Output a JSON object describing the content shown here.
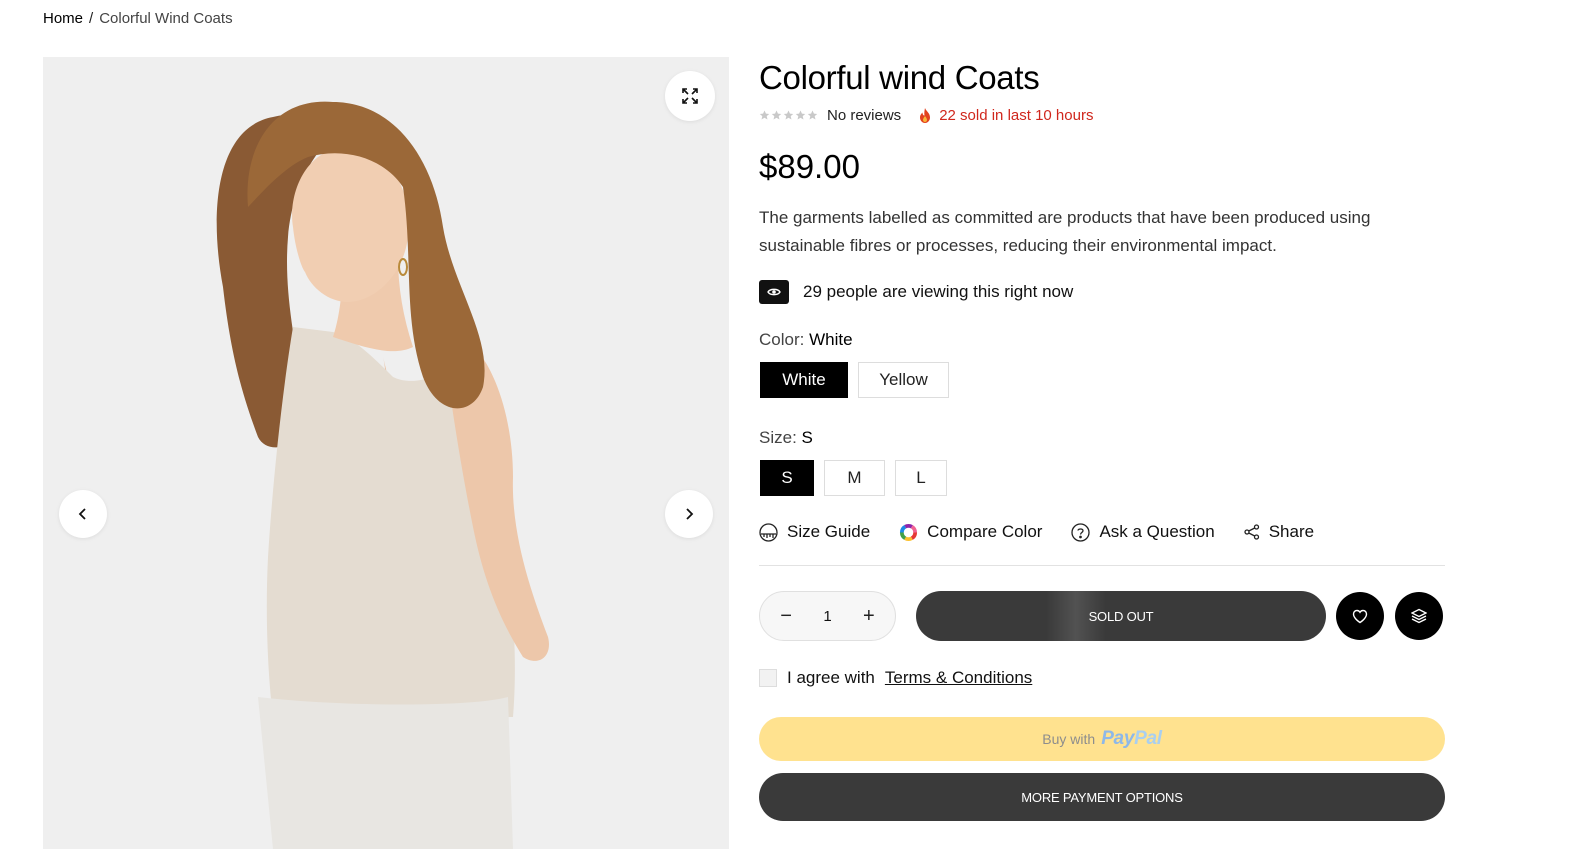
{
  "breadcrumb": {
    "home": "Home",
    "separator": "/",
    "current": "Colorful Wind Coats"
  },
  "product": {
    "title": "Colorful wind Coats",
    "reviews": "No reviews",
    "sold_text": "22 sold in last 10 hours",
    "rating": 0,
    "price": "$89.00",
    "description": "The garments labelled as committed are products that have been produced using sustainable fibres or processes, reducing their environmental impact.",
    "viewing": "29 people are viewing this right now"
  },
  "color": {
    "label": "Color:",
    "selected": "White",
    "options": [
      "White",
      "Yellow"
    ]
  },
  "size": {
    "label": "Size:",
    "selected": "S",
    "options": [
      "S",
      "M",
      "L"
    ]
  },
  "links": {
    "size_guide": "Size Guide",
    "compare_color": "Compare Color",
    "ask_question": "Ask a Question",
    "share": "Share"
  },
  "purchase": {
    "qty_minus": "−",
    "quantity": "1",
    "qty_plus": "+",
    "sold_out": "SOLD OUT"
  },
  "agree": {
    "text": "I agree with",
    "link": "Terms & Conditions"
  },
  "payment": {
    "buy_with": "Buy with",
    "paypal_pay": "Pay",
    "paypal_pal": "Pal",
    "more_options": "MORE PAYMENT OPTIONS"
  },
  "colors": {
    "sold_accent": "#d0271d",
    "paypal_bg": "#ffe28f",
    "dark_button": "#3a3a3a"
  },
  "icons": [
    "expand-icon",
    "chevron-left-icon",
    "chevron-right-icon",
    "star-icon",
    "fire-icon",
    "eye-icon",
    "ruler-icon",
    "color-wheel-icon",
    "question-icon",
    "share-icon",
    "heart-icon",
    "layers-icon"
  ]
}
